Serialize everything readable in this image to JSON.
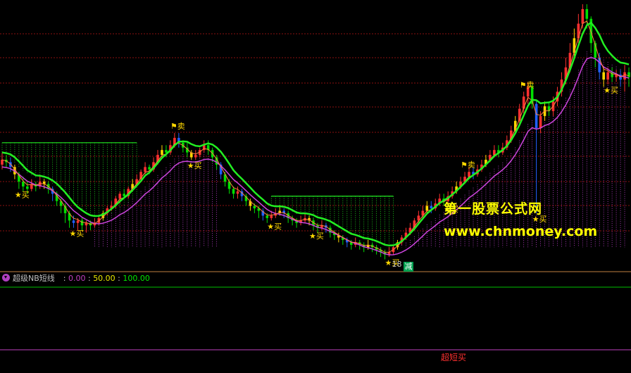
{
  "chart_data": {
    "type": "candlestick",
    "title": "",
    "x_range": [
      0,
      180
    ],
    "y_range": [
      0,
      100
    ],
    "candles": [
      [
        0,
        80,
        82,
        85,
        78
      ],
      [
        1,
        82,
        81,
        84,
        79
      ],
      [
        2,
        81,
        79,
        83,
        77
      ],
      [
        3,
        79,
        76,
        80,
        74
      ],
      [
        4,
        76,
        73,
        77,
        70
      ],
      [
        5,
        73,
        71,
        75,
        69
      ],
      [
        6,
        71,
        70,
        73,
        68
      ],
      [
        7,
        70,
        72,
        74,
        69
      ],
      [
        8,
        72,
        71,
        73,
        69
      ],
      [
        9,
        71,
        73,
        75,
        70
      ],
      [
        10,
        73,
        72,
        74,
        70
      ],
      [
        11,
        72,
        70,
        73,
        68
      ],
      [
        12,
        70,
        68,
        71,
        65
      ],
      [
        13,
        68,
        65,
        69,
        63
      ],
      [
        14,
        65,
        63,
        66,
        60
      ],
      [
        15,
        63,
        60,
        64,
        56
      ],
      [
        16,
        60,
        57,
        61,
        54
      ],
      [
        17,
        57,
        56,
        59,
        54
      ],
      [
        18,
        56,
        57,
        58,
        53
      ],
      [
        19,
        57,
        55,
        58,
        53
      ],
      [
        20,
        55,
        56,
        57,
        52
      ],
      [
        21,
        56,
        55,
        57,
        53
      ],
      [
        22,
        55,
        56,
        58,
        54
      ],
      [
        23,
        56,
        58,
        59,
        55
      ],
      [
        24,
        58,
        60,
        61,
        57
      ],
      [
        25,
        60,
        62,
        63,
        59
      ],
      [
        26,
        62,
        63,
        65,
        61
      ],
      [
        27,
        63,
        66,
        67,
        62
      ],
      [
        28,
        66,
        68,
        69,
        64
      ],
      [
        29,
        68,
        67,
        70,
        66
      ],
      [
        30,
        67,
        70,
        71,
        66
      ],
      [
        31,
        70,
        72,
        74,
        69
      ],
      [
        32,
        72,
        74,
        76,
        71
      ],
      [
        33,
        74,
        77,
        78,
        73
      ],
      [
        34,
        77,
        79,
        81,
        76
      ],
      [
        35,
        79,
        78,
        80,
        76
      ],
      [
        36,
        78,
        81,
        83,
        77
      ],
      [
        37,
        81,
        84,
        86,
        80
      ],
      [
        38,
        84,
        86,
        88,
        83
      ],
      [
        39,
        86,
        85,
        88,
        83
      ],
      [
        40,
        85,
        88,
        90,
        84
      ],
      [
        41,
        88,
        91,
        93,
        87
      ],
      [
        42,
        91,
        89,
        93,
        87
      ],
      [
        43,
        89,
        87,
        90,
        85
      ],
      [
        44,
        87,
        85,
        89,
        83
      ],
      [
        45,
        85,
        83,
        86,
        82
      ],
      [
        46,
        83,
        84,
        86,
        82
      ],
      [
        47,
        84,
        86,
        87,
        83
      ],
      [
        48,
        86,
        88,
        90,
        85
      ],
      [
        49,
        88,
        86,
        90,
        84
      ],
      [
        50,
        86,
        83,
        87,
        81
      ],
      [
        51,
        83,
        80,
        84,
        78
      ],
      [
        52,
        80,
        76,
        81,
        74
      ],
      [
        53,
        76,
        73,
        77,
        71
      ],
      [
        54,
        73,
        70,
        74,
        68
      ],
      [
        55,
        70,
        68,
        71,
        66
      ],
      [
        56,
        68,
        69,
        71,
        66
      ],
      [
        57,
        69,
        67,
        70,
        65
      ],
      [
        58,
        67,
        65,
        68,
        63
      ],
      [
        59,
        65,
        63,
        66,
        61
      ],
      [
        60,
        63,
        62,
        64,
        60
      ],
      [
        61,
        62,
        61,
        63,
        58
      ],
      [
        62,
        61,
        59,
        62,
        57
      ],
      [
        63,
        59,
        58,
        60,
        56
      ],
      [
        64,
        58,
        59,
        61,
        57
      ],
      [
        65,
        59,
        60,
        62,
        58
      ],
      [
        66,
        60,
        61,
        63,
        59
      ],
      [
        67,
        61,
        60,
        62,
        58
      ],
      [
        68,
        60,
        58,
        61,
        56
      ],
      [
        69,
        58,
        57,
        59,
        55
      ],
      [
        70,
        57,
        56,
        58,
        54
      ],
      [
        71,
        56,
        57,
        59,
        55
      ],
      [
        72,
        57,
        58,
        60,
        56
      ],
      [
        73,
        58,
        57,
        59,
        55
      ],
      [
        74,
        57,
        55,
        58,
        53
      ],
      [
        75,
        55,
        54,
        56,
        52
      ],
      [
        76,
        54,
        55,
        57,
        53
      ],
      [
        77,
        55,
        54,
        56,
        52
      ],
      [
        78,
        54,
        52,
        55,
        50
      ],
      [
        79,
        52,
        51,
        53,
        49
      ],
      [
        80,
        51,
        50,
        52,
        48
      ],
      [
        81,
        50,
        49,
        51,
        47
      ],
      [
        82,
        49,
        48,
        50,
        46
      ],
      [
        83,
        48,
        47,
        49,
        45
      ],
      [
        84,
        47,
        48,
        50,
        46
      ],
      [
        85,
        48,
        47,
        49,
        45
      ],
      [
        86,
        47,
        46,
        48,
        44
      ],
      [
        87,
        46,
        47,
        49,
        45
      ],
      [
        88,
        47,
        46,
        48,
        44
      ],
      [
        89,
        46,
        45,
        47,
        43
      ],
      [
        90,
        45,
        44,
        46,
        42
      ],
      [
        91,
        44,
        43,
        45,
        41
      ],
      [
        92,
        43,
        44,
        46,
        42
      ],
      [
        93,
        44,
        46,
        47,
        43
      ],
      [
        94,
        46,
        48,
        49,
        45
      ],
      [
        95,
        48,
        50,
        51,
        47
      ],
      [
        96,
        50,
        52,
        54,
        49
      ],
      [
        97,
        52,
        54,
        56,
        51
      ],
      [
        98,
        54,
        57,
        58,
        53
      ],
      [
        99,
        57,
        59,
        61,
        56
      ],
      [
        100,
        59,
        61,
        63,
        58
      ],
      [
        101,
        61,
        63,
        65,
        60
      ],
      [
        102,
        63,
        62,
        65,
        60
      ],
      [
        103,
        62,
        64,
        66,
        61
      ],
      [
        104,
        64,
        66,
        68,
        63
      ],
      [
        105,
        66,
        65,
        68,
        63
      ],
      [
        106,
        65,
        67,
        69,
        64
      ],
      [
        107,
        67,
        69,
        71,
        66
      ],
      [
        108,
        69,
        71,
        73,
        68
      ],
      [
        109,
        71,
        73,
        75,
        70
      ],
      [
        110,
        73,
        75,
        77,
        72
      ],
      [
        111,
        75,
        77,
        79,
        74
      ],
      [
        112,
        77,
        76,
        79,
        74
      ],
      [
        113,
        76,
        78,
        80,
        75
      ],
      [
        114,
        78,
        80,
        82,
        77
      ],
      [
        115,
        80,
        82,
        84,
        79
      ],
      [
        116,
        82,
        84,
        86,
        81
      ],
      [
        117,
        84,
        86,
        88,
        83
      ],
      [
        118,
        86,
        85,
        88,
        83
      ],
      [
        119,
        85,
        87,
        89,
        84
      ],
      [
        120,
        87,
        90,
        92,
        86
      ],
      [
        121,
        90,
        94,
        96,
        89
      ],
      [
        122,
        94,
        98,
        100,
        93
      ],
      [
        123,
        98,
        103,
        105,
        97
      ],
      [
        124,
        103,
        108,
        110,
        101
      ],
      [
        125,
        108,
        112,
        114,
        105
      ],
      [
        126,
        112,
        105,
        113,
        103
      ],
      [
        127,
        105,
        95,
        106,
        60
      ],
      [
        128,
        95,
        100,
        102,
        93
      ],
      [
        129,
        100,
        104,
        106,
        98
      ],
      [
        130,
        104,
        102,
        106,
        100
      ],
      [
        131,
        102,
        106,
        108,
        100
      ],
      [
        132,
        106,
        110,
        112,
        104
      ],
      [
        133,
        110,
        115,
        118,
        108
      ],
      [
        134,
        115,
        120,
        124,
        113
      ],
      [
        135,
        120,
        126,
        130,
        118
      ],
      [
        136,
        126,
        132,
        136,
        124
      ],
      [
        137,
        132,
        138,
        142,
        130
      ],
      [
        138,
        138,
        144,
        146,
        136
      ],
      [
        139,
        144,
        140,
        146,
        136
      ],
      [
        140,
        140,
        130,
        141,
        126
      ],
      [
        141,
        130,
        124,
        131,
        120
      ],
      [
        142,
        124,
        118,
        126,
        115
      ],
      [
        143,
        118,
        115,
        120,
        112
      ],
      [
        144,
        115,
        118,
        120,
        113
      ],
      [
        145,
        118,
        116,
        120,
        114
      ],
      [
        146,
        116,
        117,
        119,
        114
      ],
      [
        147,
        117,
        115,
        119,
        112
      ],
      [
        148,
        115,
        118,
        121,
        110
      ],
      [
        149,
        118,
        116,
        120,
        112
      ]
    ],
    "ma_fast": "close_ema_3",
    "ma_slow": "close_ema_10",
    "signals": [
      {
        "x": 4,
        "label": "买",
        "type": "buy"
      },
      {
        "x": 17,
        "label": "买",
        "type": "buy"
      },
      {
        "x": 41,
        "label": "卖",
        "type": "sell"
      },
      {
        "x": 45,
        "label": "买",
        "type": "buy"
      },
      {
        "x": 64,
        "label": "买",
        "type": "buy"
      },
      {
        "x": 74,
        "label": "买",
        "type": "buy"
      },
      {
        "x": 92,
        "label": "买",
        "type": "buy"
      },
      {
        "x": 106,
        "label": "买",
        "type": "buy"
      },
      {
        "x": 110,
        "label": "卖",
        "type": "sell"
      },
      {
        "x": 124,
        "label": "卖",
        "type": "sell"
      },
      {
        "x": 127,
        "label": "买",
        "type": "buy"
      },
      {
        "x": 144,
        "label": "买",
        "type": "buy"
      }
    ],
    "annotations": [
      {
        "x": 92,
        "text": "18"
      }
    ],
    "indicator": {
      "name": "超级NB短线",
      "values": [
        "0.00",
        "50.00",
        "100.00"
      ],
      "bottom_label": "超短买",
      "marker_label": "减"
    }
  },
  "watermark": {
    "cn": "第一股票公式网",
    "url": "www.chnmoney.com"
  },
  "colors": {
    "up": "#ff3030",
    "down": "#00e000",
    "yellow": "#ffd800",
    "blue": "#2060ff",
    "band": "#cc44dd",
    "trail": "#22ee22",
    "grid": "#8b1010"
  }
}
